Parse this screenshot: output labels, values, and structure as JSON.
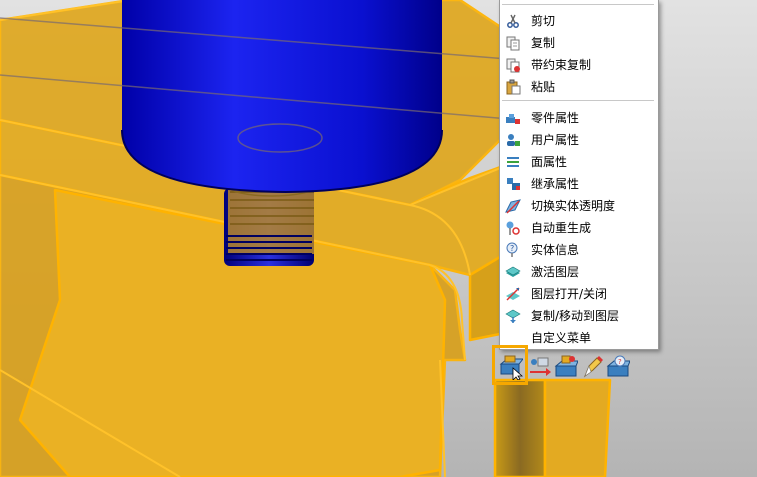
{
  "context_menu": {
    "items": [
      {
        "label": "剪切",
        "icon": "scissors-icon"
      },
      {
        "label": "复制",
        "icon": "copy-icon"
      },
      {
        "label": "带约束复制",
        "icon": "copy-with-constraints-icon"
      },
      {
        "label": "粘贴",
        "icon": "paste-icon"
      },
      {
        "label": "零件属性",
        "icon": "part-properties-icon"
      },
      {
        "label": "用户属性",
        "icon": "user-properties-icon"
      },
      {
        "label": "面属性",
        "icon": "face-properties-icon"
      },
      {
        "label": "继承属性",
        "icon": "inherit-properties-icon"
      },
      {
        "label": "切换实体透明度",
        "icon": "toggle-transparency-icon"
      },
      {
        "label": "自动重生成",
        "icon": "auto-regenerate-icon"
      },
      {
        "label": "实体信息",
        "icon": "entity-info-icon"
      },
      {
        "label": "激活图层",
        "icon": "activate-layer-icon"
      },
      {
        "label": "图层打开/关闭",
        "icon": "layer-on-off-icon"
      },
      {
        "label": "复制/移动到图层",
        "icon": "copy-move-to-layer-icon"
      },
      {
        "label": "自定义菜单",
        "icon": "custom-menu-icon"
      }
    ]
  },
  "mini_toolbar": {
    "buttons": [
      {
        "icon": "pick-part-icon",
        "active": true
      },
      {
        "icon": "move-constraint-icon",
        "active": false
      },
      {
        "icon": "align-part-icon",
        "active": false
      },
      {
        "icon": "edit-pencil-icon",
        "active": false
      },
      {
        "icon": "part-info-icon",
        "active": false
      }
    ]
  },
  "colors": {
    "frame_yellow": "#e9ad1f",
    "frame_edge": "#ffb300",
    "cylinder_blue": "#0a10d8",
    "highlight_orange": "#f6a800",
    "background_gray": "#c9c9c9"
  }
}
